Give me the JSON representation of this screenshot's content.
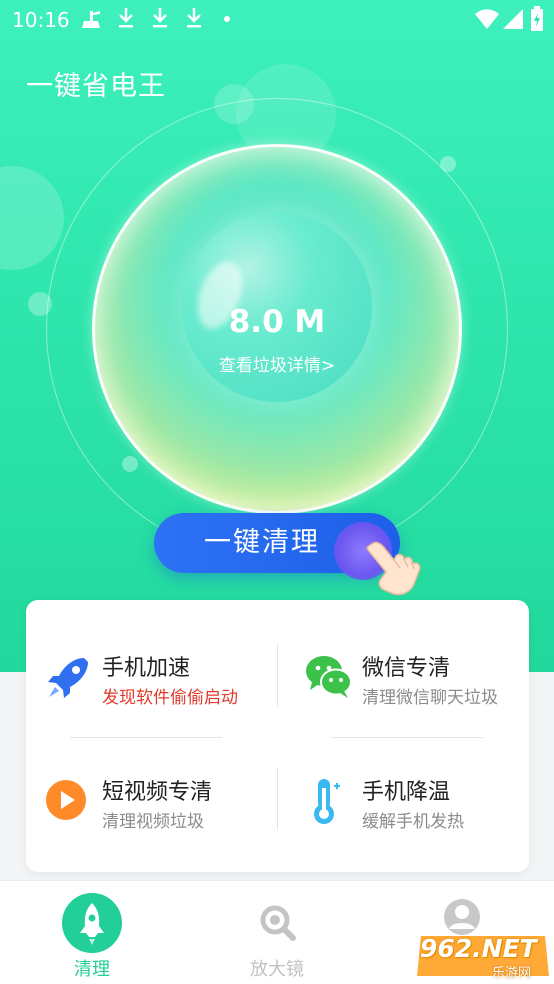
{
  "status_bar": {
    "time": "10:16",
    "icons": [
      "broom-icon",
      "download-icon",
      "download-icon",
      "download-icon",
      "dot-icon",
      "wifi-icon",
      "signal-icon",
      "battery-icon"
    ]
  },
  "app": {
    "title": "一键省电王"
  },
  "scan": {
    "size": "8.0 M",
    "detail_link": "查看垃圾详情>"
  },
  "clean_button": {
    "label": "一键清理"
  },
  "features": [
    {
      "title": "手机加速",
      "subtitle": "发现软件偷偷启动",
      "icon": "rocket-icon",
      "subtitle_color": "#e23a2b"
    },
    {
      "title": "微信专清",
      "subtitle": "清理微信聊天垃圾",
      "icon": "wechat-icon"
    },
    {
      "title": "短视频专清",
      "subtitle": "清理视频垃圾",
      "icon": "play-icon"
    },
    {
      "title": "手机降温",
      "subtitle": "缓解手机发热",
      "icon": "thermometer-icon"
    }
  ],
  "bottom_nav": [
    {
      "label": "清理",
      "icon": "rocket-icon",
      "active": true
    },
    {
      "label": "放大镜",
      "icon": "magnifier-icon",
      "active": false
    },
    {
      "label": "",
      "icon": "profile-icon",
      "active": false
    }
  ],
  "watermark": {
    "text": "962.NET",
    "sub": "乐游网"
  },
  "colors": {
    "accent": "#22cf98",
    "hero_top": "#3ef0bd",
    "button_blue": "#1d5fe8",
    "alert_red": "#e23a2b"
  }
}
